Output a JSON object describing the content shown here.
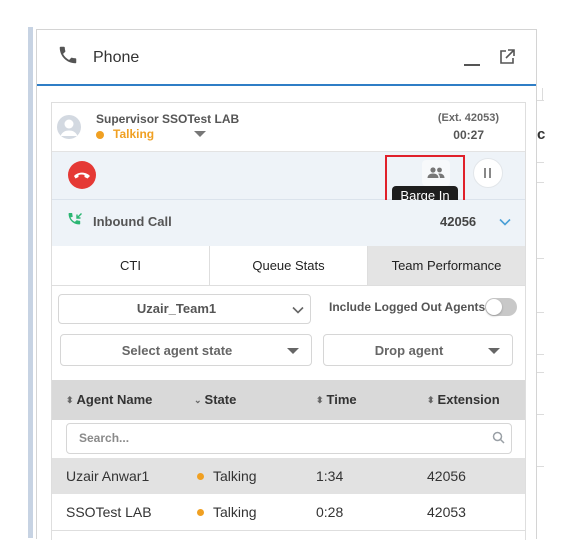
{
  "panel": {
    "title": "Phone"
  },
  "caller": {
    "name": "Supervisor SSOTest LAB",
    "status": "Talking",
    "extension": "(Ext. 42053)",
    "timer": "00:27"
  },
  "controls": {
    "tooltip": "Barge In"
  },
  "inbound": {
    "label": "Inbound Call",
    "extension": "42056"
  },
  "tabs": [
    {
      "label": "CTI"
    },
    {
      "label": "Queue Stats"
    },
    {
      "label": "Team Performance",
      "active": true
    }
  ],
  "filters": {
    "team": "Uzair_Team1",
    "include_logged_out_label": "Include Logged Out Agents",
    "include_logged_out": false,
    "agent_state_placeholder": "Select agent state",
    "drop_agent_label": "Drop agent"
  },
  "table": {
    "columns": [
      "Agent Name",
      "State",
      "Time",
      "Extension"
    ],
    "search_placeholder": "Search...",
    "rows": [
      {
        "name": "Uzair Anwar1",
        "state": "Talking",
        "time": "1:34",
        "extension": "42056"
      },
      {
        "name": "SSOTest LAB",
        "state": "Talking",
        "time": "0:28",
        "extension": "42053"
      }
    ]
  },
  "colors": {
    "accent": "#2f7ec6",
    "talking": "#f0a022",
    "hangup": "#e53935",
    "inbound_icon": "#2bb673",
    "highlight": "#e0202a"
  },
  "icons": [
    "phone-icon",
    "minimize-icon",
    "popout-icon",
    "avatar-icon",
    "hangup-icon",
    "barge-in-icon",
    "hold-icon",
    "inbound-call-icon",
    "chevron-down-icon",
    "search-icon",
    "sort-icon"
  ]
}
